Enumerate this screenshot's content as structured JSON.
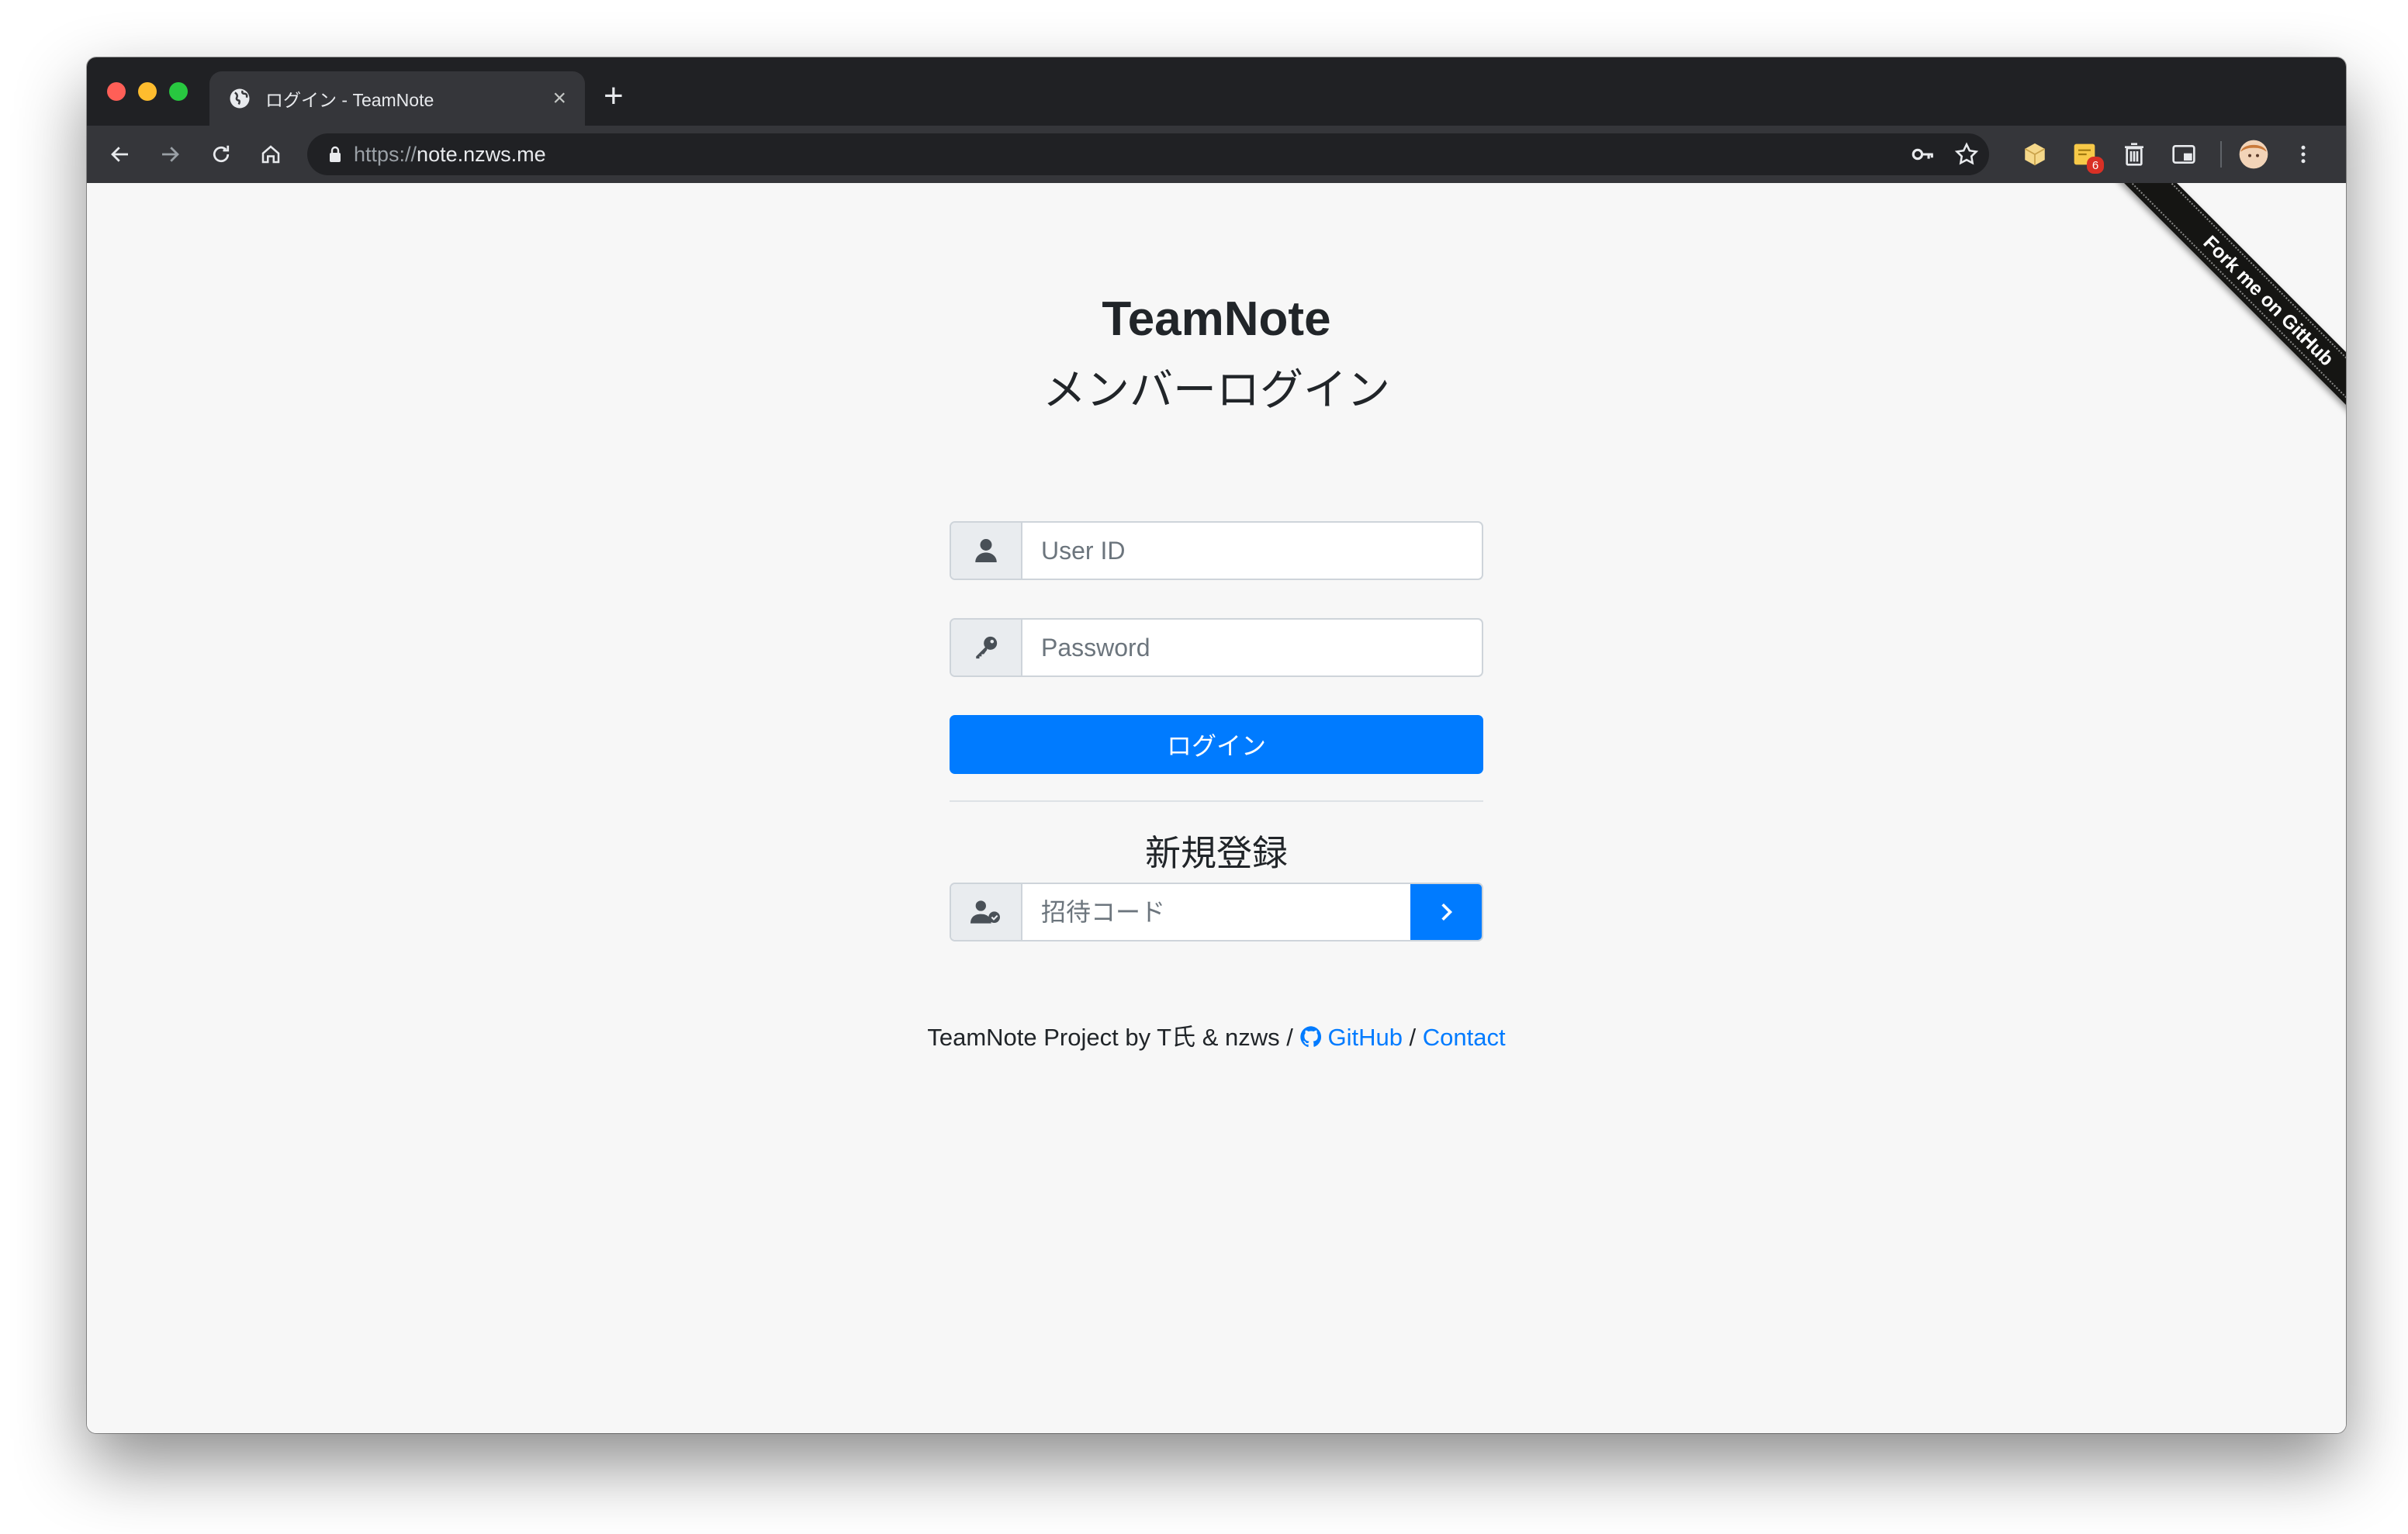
{
  "browser": {
    "tab_title": "ログイン - TeamNote",
    "tab_close": "×",
    "new_tab": "+",
    "url_protocol": "https://",
    "url_host": "note.nzws.me",
    "extension_badge": "6"
  },
  "page": {
    "title": "TeamNote",
    "subtitle": "メンバーログイン",
    "user_id_placeholder": "User ID",
    "password_placeholder": "Password",
    "login_button": "ログイン",
    "register_title": "新規登録",
    "invite_placeholder": "招待コード",
    "ribbon": "Fork me on GitHub"
  },
  "footer": {
    "text": "TeamNote Project by T氏 & nzws / ",
    "github_label": "GitHub",
    "separator": " / ",
    "contact_label": "Contact"
  },
  "colors": {
    "primary": "#007bff",
    "chrome_dark": "#202124",
    "chrome_toolbar": "#35363a",
    "page_bg": "#f7f7f7"
  }
}
